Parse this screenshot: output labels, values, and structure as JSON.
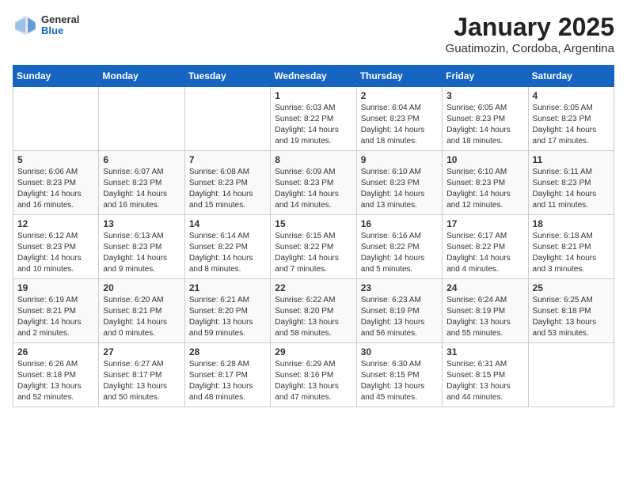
{
  "header": {
    "logo": {
      "line1": "General",
      "line2": "Blue"
    },
    "title": "January 2025",
    "subtitle": "Guatimozin, Cordoba, Argentina"
  },
  "days_of_week": [
    "Sunday",
    "Monday",
    "Tuesday",
    "Wednesday",
    "Thursday",
    "Friday",
    "Saturday"
  ],
  "weeks": [
    [
      {
        "day": "",
        "info": ""
      },
      {
        "day": "",
        "info": ""
      },
      {
        "day": "",
        "info": ""
      },
      {
        "day": "1",
        "info": "Sunrise: 6:03 AM\nSunset: 8:22 PM\nDaylight: 14 hours and 19 minutes."
      },
      {
        "day": "2",
        "info": "Sunrise: 6:04 AM\nSunset: 8:23 PM\nDaylight: 14 hours and 18 minutes."
      },
      {
        "day": "3",
        "info": "Sunrise: 6:05 AM\nSunset: 8:23 PM\nDaylight: 14 hours and 18 minutes."
      },
      {
        "day": "4",
        "info": "Sunrise: 6:05 AM\nSunset: 8:23 PM\nDaylight: 14 hours and 17 minutes."
      }
    ],
    [
      {
        "day": "5",
        "info": "Sunrise: 6:06 AM\nSunset: 8:23 PM\nDaylight: 14 hours and 16 minutes."
      },
      {
        "day": "6",
        "info": "Sunrise: 6:07 AM\nSunset: 8:23 PM\nDaylight: 14 hours and 16 minutes."
      },
      {
        "day": "7",
        "info": "Sunrise: 6:08 AM\nSunset: 8:23 PM\nDaylight: 14 hours and 15 minutes."
      },
      {
        "day": "8",
        "info": "Sunrise: 6:09 AM\nSunset: 8:23 PM\nDaylight: 14 hours and 14 minutes."
      },
      {
        "day": "9",
        "info": "Sunrise: 6:10 AM\nSunset: 8:23 PM\nDaylight: 14 hours and 13 minutes."
      },
      {
        "day": "10",
        "info": "Sunrise: 6:10 AM\nSunset: 8:23 PM\nDaylight: 14 hours and 12 minutes."
      },
      {
        "day": "11",
        "info": "Sunrise: 6:11 AM\nSunset: 8:23 PM\nDaylight: 14 hours and 11 minutes."
      }
    ],
    [
      {
        "day": "12",
        "info": "Sunrise: 6:12 AM\nSunset: 8:23 PM\nDaylight: 14 hours and 10 minutes."
      },
      {
        "day": "13",
        "info": "Sunrise: 6:13 AM\nSunset: 8:23 PM\nDaylight: 14 hours and 9 minutes."
      },
      {
        "day": "14",
        "info": "Sunrise: 6:14 AM\nSunset: 8:22 PM\nDaylight: 14 hours and 8 minutes."
      },
      {
        "day": "15",
        "info": "Sunrise: 6:15 AM\nSunset: 8:22 PM\nDaylight: 14 hours and 7 minutes."
      },
      {
        "day": "16",
        "info": "Sunrise: 6:16 AM\nSunset: 8:22 PM\nDaylight: 14 hours and 5 minutes."
      },
      {
        "day": "17",
        "info": "Sunrise: 6:17 AM\nSunset: 8:22 PM\nDaylight: 14 hours and 4 minutes."
      },
      {
        "day": "18",
        "info": "Sunrise: 6:18 AM\nSunset: 8:21 PM\nDaylight: 14 hours and 3 minutes."
      }
    ],
    [
      {
        "day": "19",
        "info": "Sunrise: 6:19 AM\nSunset: 8:21 PM\nDaylight: 14 hours and 2 minutes."
      },
      {
        "day": "20",
        "info": "Sunrise: 6:20 AM\nSunset: 8:21 PM\nDaylight: 14 hours and 0 minutes."
      },
      {
        "day": "21",
        "info": "Sunrise: 6:21 AM\nSunset: 8:20 PM\nDaylight: 13 hours and 59 minutes."
      },
      {
        "day": "22",
        "info": "Sunrise: 6:22 AM\nSunset: 8:20 PM\nDaylight: 13 hours and 58 minutes."
      },
      {
        "day": "23",
        "info": "Sunrise: 6:23 AM\nSunset: 8:19 PM\nDaylight: 13 hours and 56 minutes."
      },
      {
        "day": "24",
        "info": "Sunrise: 6:24 AM\nSunset: 8:19 PM\nDaylight: 13 hours and 55 minutes."
      },
      {
        "day": "25",
        "info": "Sunrise: 6:25 AM\nSunset: 8:18 PM\nDaylight: 13 hours and 53 minutes."
      }
    ],
    [
      {
        "day": "26",
        "info": "Sunrise: 6:26 AM\nSunset: 8:18 PM\nDaylight: 13 hours and 52 minutes."
      },
      {
        "day": "27",
        "info": "Sunrise: 6:27 AM\nSunset: 8:17 PM\nDaylight: 13 hours and 50 minutes."
      },
      {
        "day": "28",
        "info": "Sunrise: 6:28 AM\nSunset: 8:17 PM\nDaylight: 13 hours and 48 minutes."
      },
      {
        "day": "29",
        "info": "Sunrise: 6:29 AM\nSunset: 8:16 PM\nDaylight: 13 hours and 47 minutes."
      },
      {
        "day": "30",
        "info": "Sunrise: 6:30 AM\nSunset: 8:15 PM\nDaylight: 13 hours and 45 minutes."
      },
      {
        "day": "31",
        "info": "Sunrise: 6:31 AM\nSunset: 8:15 PM\nDaylight: 13 hours and 44 minutes."
      },
      {
        "day": "",
        "info": ""
      }
    ]
  ]
}
